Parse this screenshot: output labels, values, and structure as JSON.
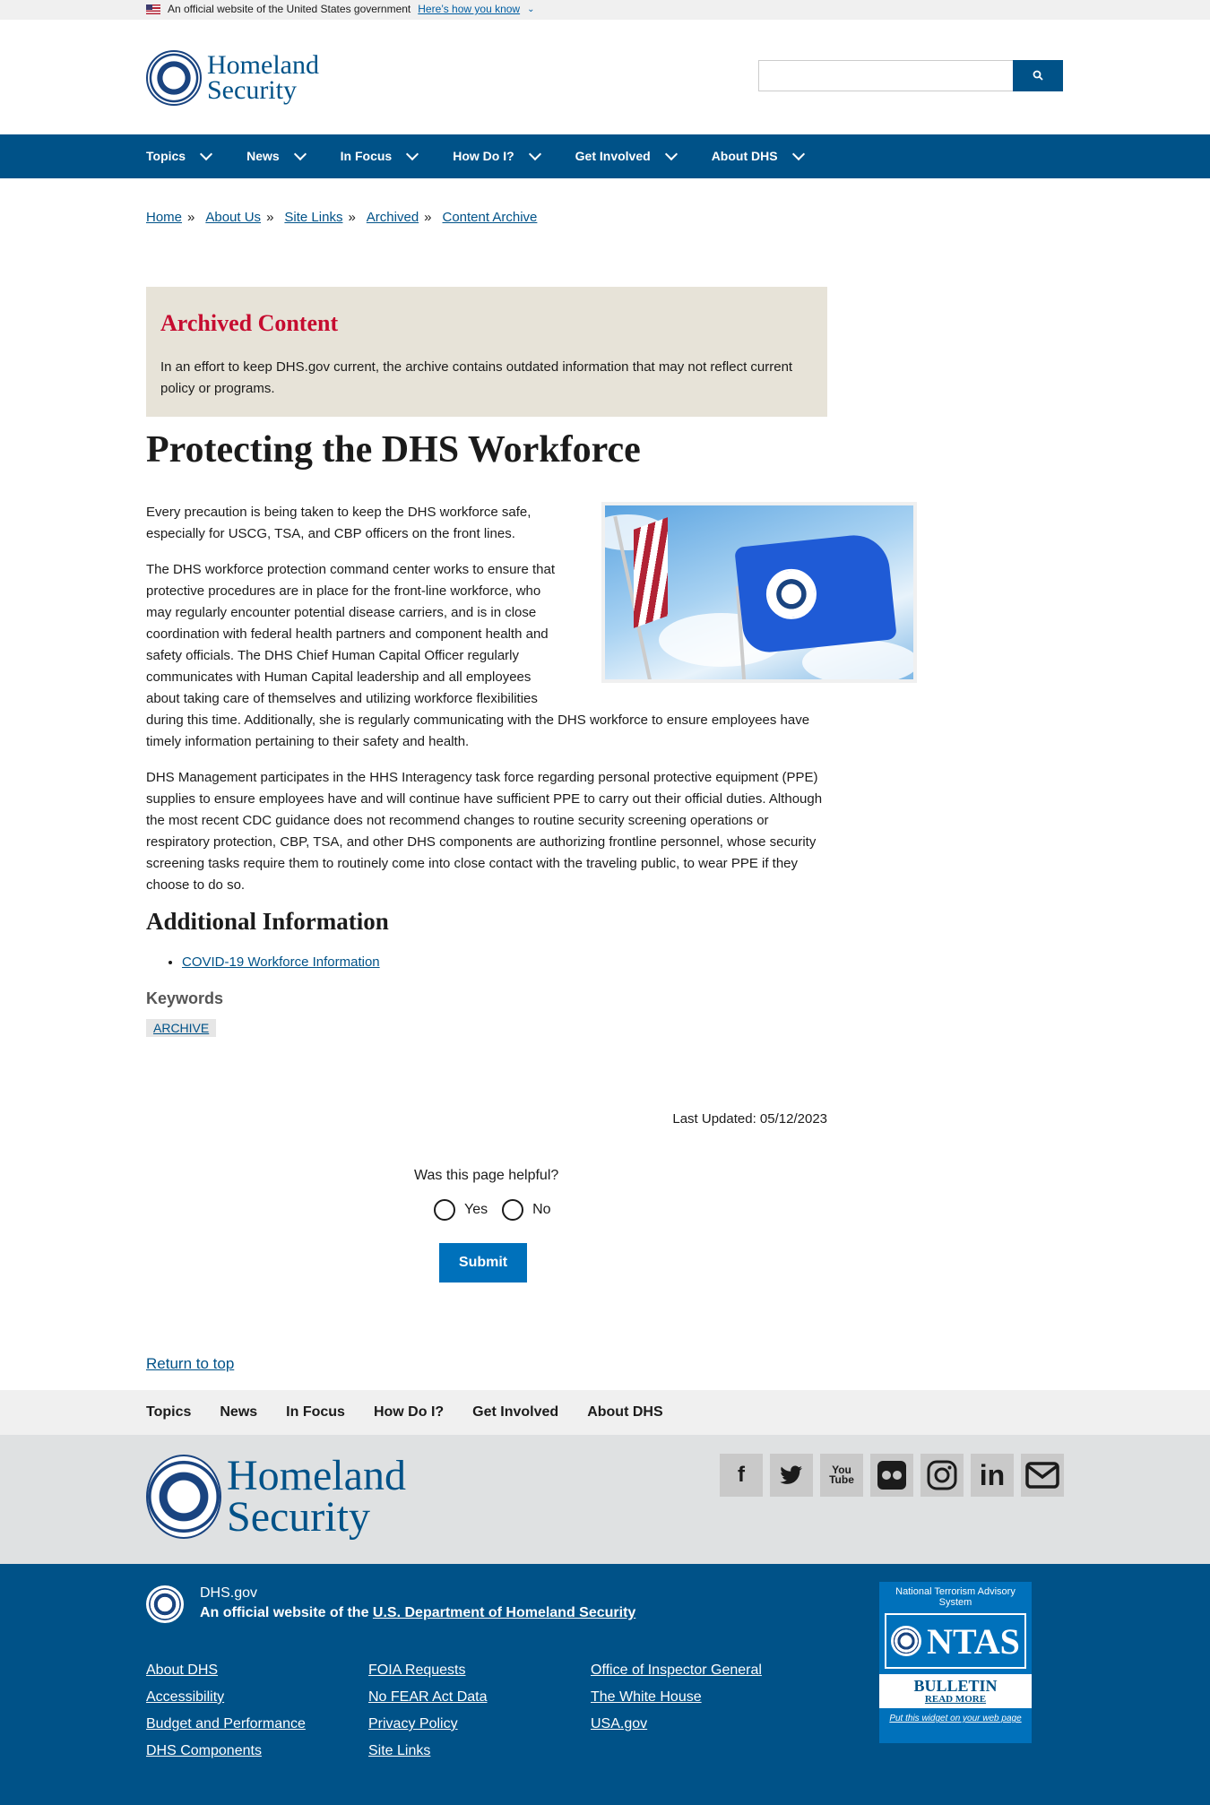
{
  "banner": {
    "text": "An official website of the United States government",
    "link": "Here’s how you know"
  },
  "header": {
    "logo_line1": "Homeland",
    "logo_line2": "Security",
    "search_button_icon": "search-icon"
  },
  "nav": {
    "items": [
      "Topics",
      "News",
      "In Focus",
      "How Do I?",
      "Get Involved",
      "About DHS"
    ]
  },
  "breadcrumb": [
    "Home",
    "About Us",
    "Site Links",
    "Archived",
    "Content Archive"
  ],
  "archived": {
    "heading": "Archived Content",
    "text": "In an effort to keep DHS.gov current, the archive contains outdated information that may not reflect current policy or programs."
  },
  "page": {
    "title": "Protecting the DHS Workforce",
    "paragraphs": [
      "Every precaution is being taken to keep the DHS workforce safe, especially for USCG, TSA, and CBP officers on the front lines.",
      "The DHS workforce protection command center works to ensure that protective procedures are in place for the front-line workforce, who may regularly encounter potential disease carriers, and is in close coordination with federal health partners and component health and safety officials. The DHS Chief Human Capital Officer regularly communicates with Human Capital leadership and all employees about taking care of themselves and utilizing workforce flexibilities during this time. Additionally, she is regularly communicating with the DHS workforce to ensure employees have timely information pertaining to their safety and health.",
      "DHS Management participates in the HHS Interagency task force regarding personal protective equipment (PPE) supplies to ensure employees have and will continue have sufficient PPE to carry out their official duties. Although the most recent CDC guidance does not recommend changes to routine security screening operations or respiratory protection, CBP, TSA, and other DHS components are authorizing frontline personnel, whose security screening tasks require them to routinely come into close contact with the traveling public, to wear PPE if they choose to do so."
    ],
    "additional_heading": "Additional Information",
    "additional_link": "COVID-19 Workforce Information",
    "keywords_heading": "Keywords",
    "keyword": "ARCHIVE",
    "last_updated": "Last Updated: 05/12/2023"
  },
  "feedback": {
    "question": "Was this page helpful?",
    "yes": "Yes",
    "no": "No",
    "submit": "Submit"
  },
  "return_top": "Return to top",
  "footer_nav": [
    "Topics",
    "News",
    "In Focus",
    "How Do I?",
    "Get Involved",
    "About DHS"
  ],
  "social_icons": [
    "facebook-icon",
    "twitter-icon",
    "youtube-icon",
    "flickr-icon",
    "instagram-icon",
    "linkedin-icon",
    "email-icon"
  ],
  "footer": {
    "domain": "DHS.gov",
    "official_prefix": "An official website of the",
    "official_link": "U.S. Department of Homeland Security",
    "col1": [
      "About DHS",
      "Accessibility",
      "Budget and Performance",
      "DHS Components"
    ],
    "col2": [
      "FOIA Requests",
      "No FEAR Act Data",
      "Privacy Policy",
      "Site Links"
    ],
    "col3": [
      "Office of Inspector General",
      "The White House",
      "USA.gov"
    ],
    "ntas": {
      "top": "National Terrorism Advisory System",
      "logo": "NTAS",
      "bulletin": "BULLETIN",
      "read_more": "READ MORE",
      "widget": "Put this widget on your web page"
    }
  }
}
